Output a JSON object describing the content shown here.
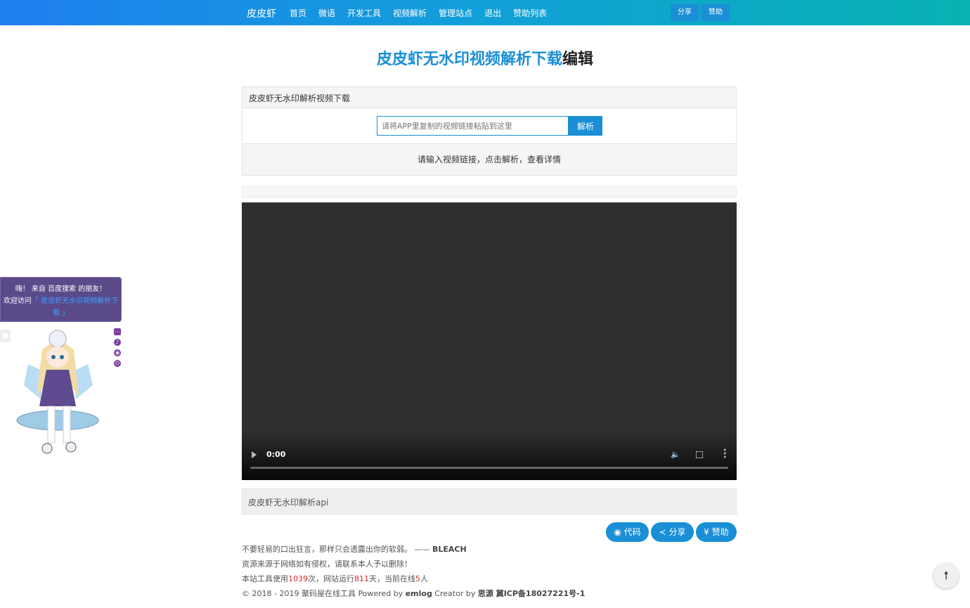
{
  "nav": {
    "brand": "皮皮虾",
    "links": [
      "首页",
      "微语",
      "开发工具",
      "视频解析",
      "管理站点",
      "退出",
      "赞助列表"
    ],
    "share": "分享",
    "sponsor": "赞助"
  },
  "title": {
    "blue": "皮皮虾无水印视频解析下载",
    "dark": "编辑"
  },
  "panel": {
    "heading": "皮皮虾无水印解析视频下载",
    "placeholder": "请将APP里复制的视频链接粘贴到这里",
    "button": "解析",
    "hint": "请输入视频链接，点击解析，查看详情"
  },
  "video": {
    "time": "0:00"
  },
  "api_label": "皮皮虾无水印解析api",
  "buttons": {
    "code": "代码",
    "share": "分享",
    "sponsor": "赞助"
  },
  "footer": {
    "quote": "不要轻易的口出狂言，那样只会透露出你的软弱。 —— ",
    "quote_author": "BLEACH",
    "notice": "资源来源于网络如有侵权，请联系本人予以删除！",
    "stats_prefix": "本站工具使用",
    "uses": "1039",
    "stats_mid1": "次，网站运行",
    "days": "811",
    "stats_mid2": "天，当前在线",
    "online": "5",
    "stats_suffix": "人",
    "copyright": "© 2018 - 2019 聚码屋在线工具 Powered by ",
    "emlog": "emlog",
    "creator": " Creator by ",
    "author": "思源",
    "icp": " 冀ICP备18027221号-1"
  },
  "mascot": {
    "greeting": "嗨！ 来自 百度搜索 的朋友！",
    "welcome": "欢迎访问",
    "site_link": "「 皮皮虾无水印视频解析下载 」"
  },
  "icons": {
    "code": "github-icon",
    "share": "share-icon",
    "sponsor": "yen-icon",
    "top": "arrow-up-icon"
  },
  "colors": {
    "accent": "#1a8fd6",
    "nav_gradient_start": "#1f7ff0",
    "nav_gradient_end": "#07b2b2",
    "stat_number": "#c9302c"
  }
}
